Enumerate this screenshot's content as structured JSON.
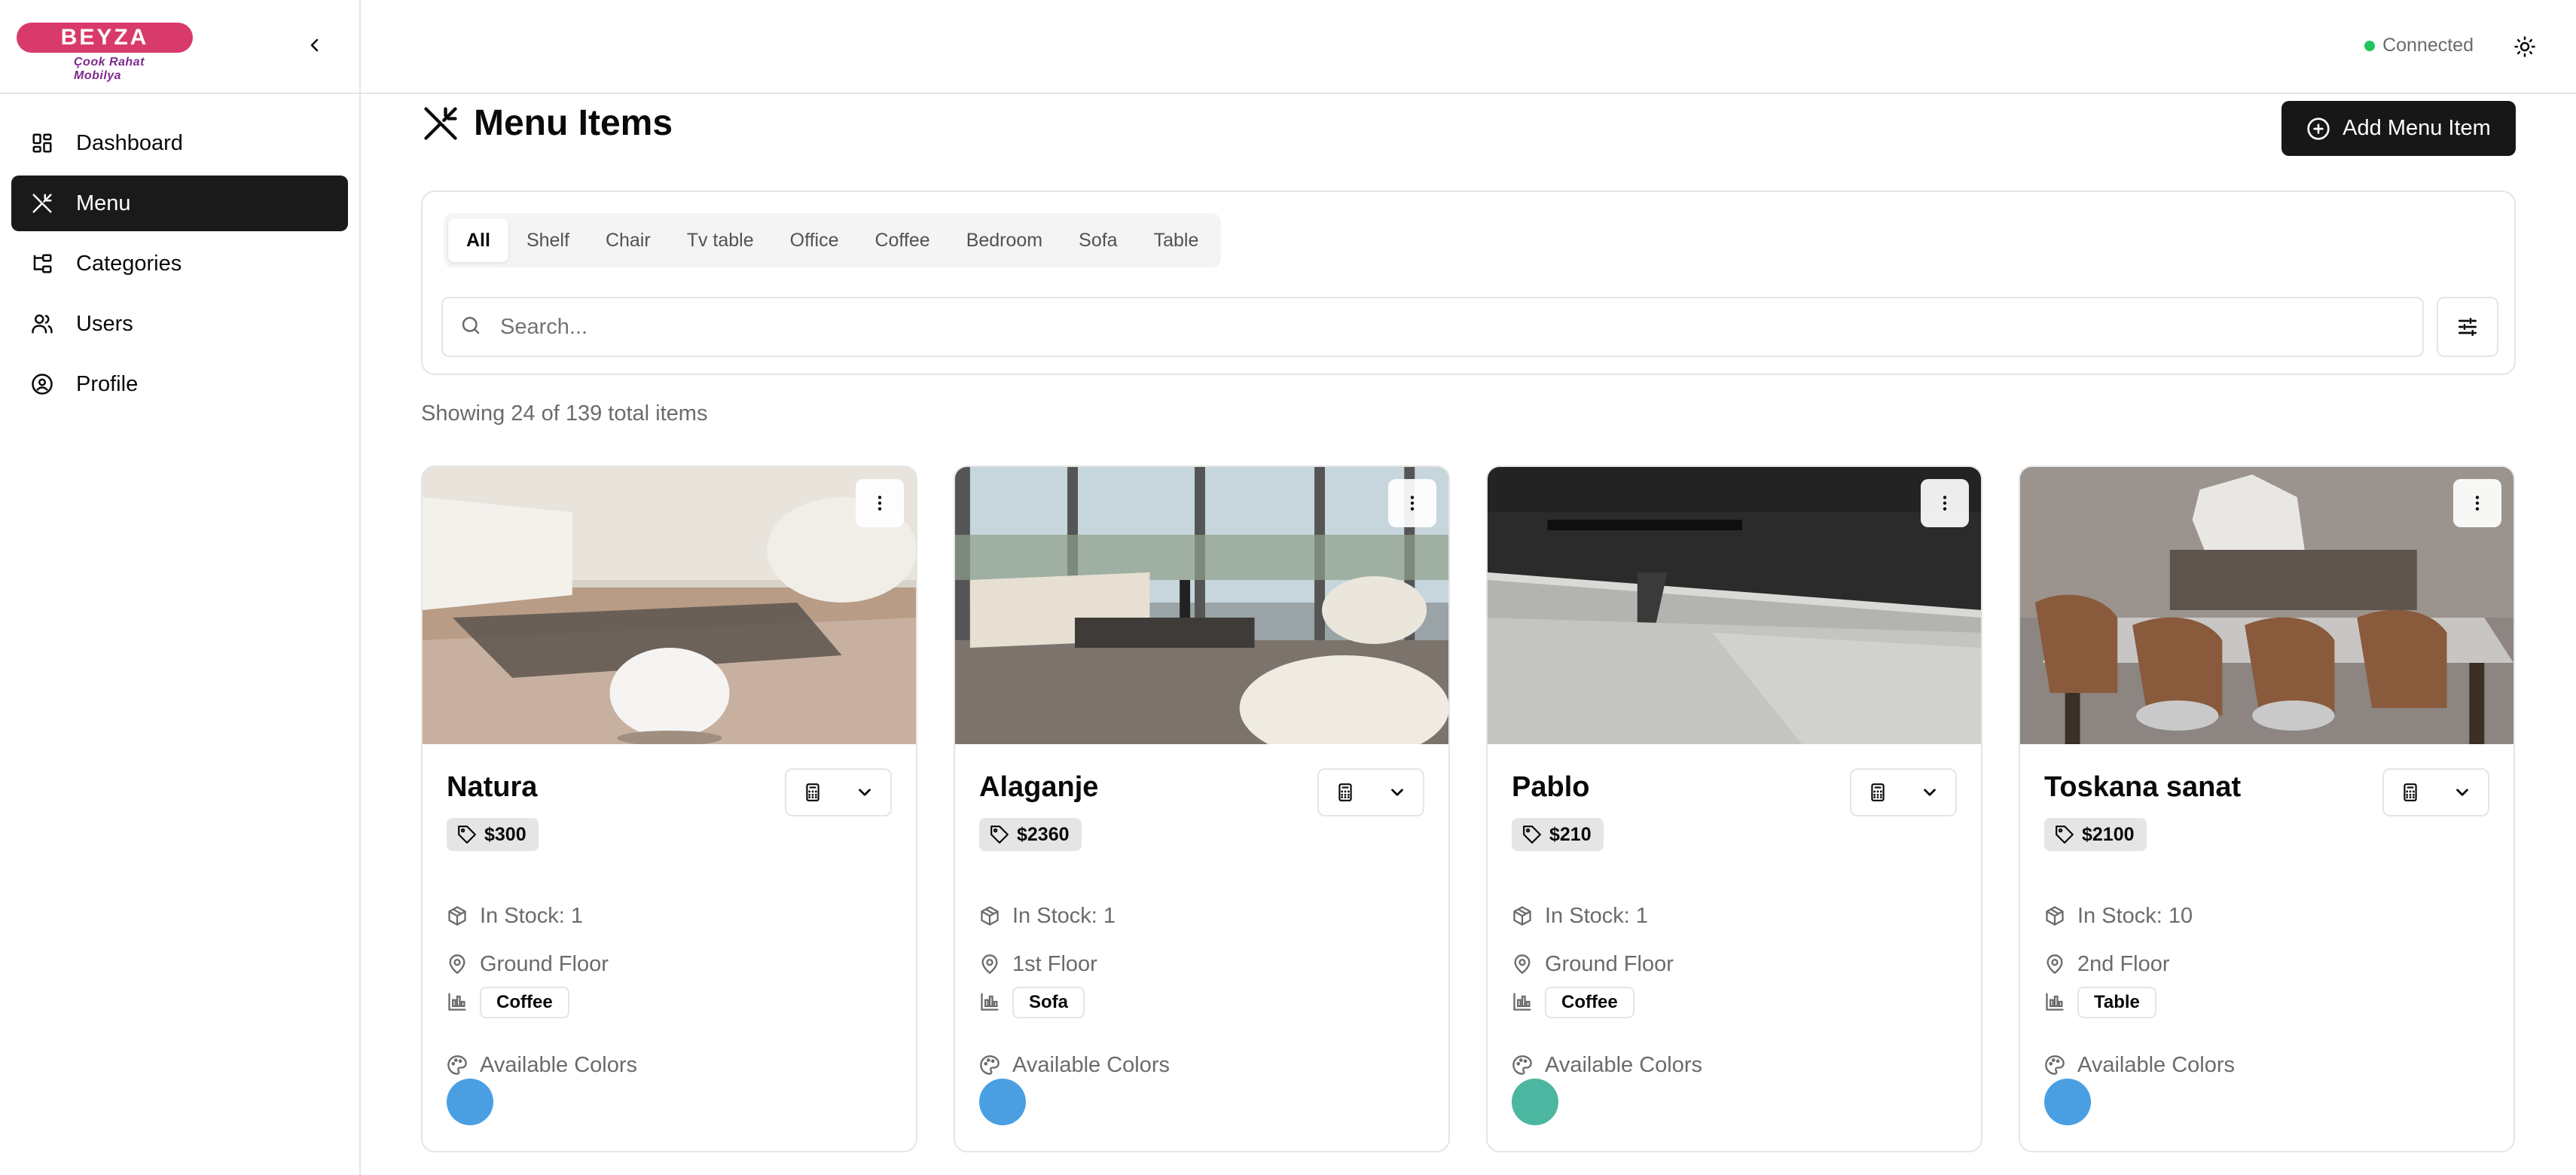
{
  "brand": {
    "name": "BEYZA",
    "tagline": "Çook Rahat Mobilya",
    "color": "#d93a6c"
  },
  "sidebar": {
    "items": [
      {
        "label": "Dashboard",
        "icon": "dashboard-icon"
      },
      {
        "label": "Menu",
        "icon": "utensils-icon",
        "active": true
      },
      {
        "label": "Categories",
        "icon": "folder-tree-icon"
      },
      {
        "label": "Users",
        "icon": "users-icon"
      },
      {
        "label": "Profile",
        "icon": "user-circle-icon"
      }
    ]
  },
  "topbar": {
    "status": "Connected",
    "status_color": "#22c55e"
  },
  "page": {
    "title": "Menu Items",
    "add_button": "Add Menu Item"
  },
  "filters": {
    "tabs": [
      "All",
      "Shelf",
      "Chair",
      "Tv table",
      "Office",
      "Coffee",
      "Bedroom",
      "Sofa",
      "Table"
    ],
    "active_tab": "All",
    "search_placeholder": "Search..."
  },
  "summary": "Showing 24 of 139 total items",
  "items": [
    {
      "name": "Natura",
      "price": "$300",
      "stock": "In Stock: 1",
      "floor": "Ground Floor",
      "category": "Coffee",
      "colors_label": "Available Colors",
      "color": "#4a9fe3",
      "image": "living-room-coffee-table"
    },
    {
      "name": "Alaganje",
      "price": "$2360",
      "stock": "In Stock: 1",
      "floor": "1st Floor",
      "category": "Sofa",
      "colors_label": "Available Colors",
      "color": "#4a9fe3",
      "image": "showroom-sofa-set"
    },
    {
      "name": "Pablo",
      "price": "$210",
      "stock": "In Stock: 1",
      "floor": "Ground Floor",
      "category": "Coffee",
      "colors_label": "Available Colors",
      "color": "#4db6a0",
      "image": "glass-table-closeup"
    },
    {
      "name": "Toskana sanat",
      "price": "$2100",
      "stock": "In Stock: 10",
      "floor": "2nd Floor",
      "category": "Table",
      "colors_label": "Available Colors",
      "color": "#4a9fe3",
      "image": "dining-table-set"
    }
  ]
}
